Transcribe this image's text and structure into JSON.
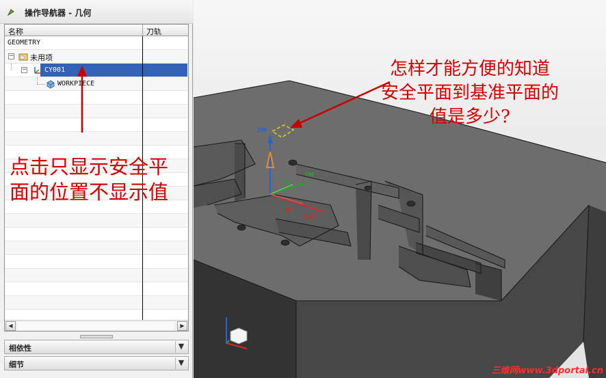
{
  "navigator": {
    "title": "操作导航器 - 几何",
    "columns": {
      "name": "名称",
      "tool_path": "刀轨"
    },
    "tree": {
      "root": "GEOMETRY",
      "unused": "未用项",
      "mcs": "CY001",
      "workpiece": "WORKPIECE"
    },
    "sections": {
      "dependencies": "相依性",
      "details": "细节"
    }
  },
  "annotations": {
    "left_note_line1": "点击只显示安全平",
    "left_note_line2": "面的位置不显示值",
    "right_note_line1": "怎样才能方便的知道",
    "right_note_line2": "安全平面到基准平面的",
    "right_note_line3": "值是多少?"
  },
  "viewport": {
    "axis_labels": {
      "zm": "ZM",
      "yc": "YC",
      "ym": "YM",
      "xc": "XC",
      "xm": "XM"
    },
    "watermark": "三维网www.3dportal.cn"
  },
  "colors": {
    "selection": "#3162b5",
    "annotation": "#d40000",
    "part_gray": "#5a5a5a"
  }
}
